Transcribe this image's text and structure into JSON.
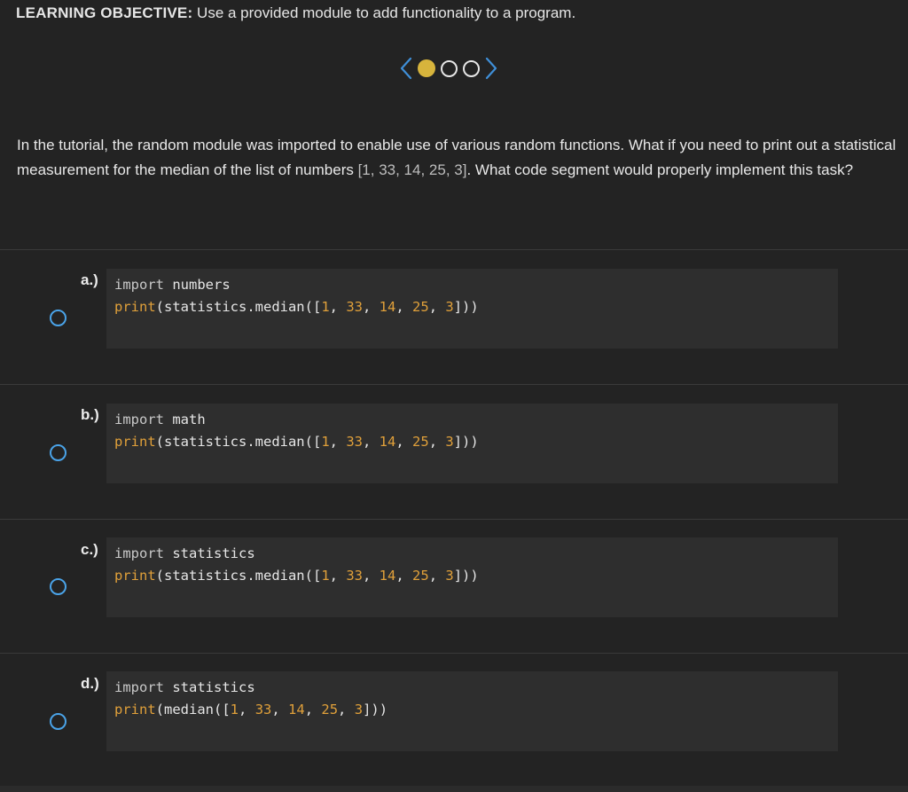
{
  "objective": {
    "label": "LEARNING OBJECTIVE:",
    "text": " Use a provided module to add functionality to a program."
  },
  "pager": {
    "prev_icon": "chevron-left-icon",
    "next_icon": "chevron-right-icon",
    "total": 3,
    "current": 1,
    "colors": {
      "chevron": "#3f8fd8",
      "active": "#d7b43c",
      "inactive": "#e6e6e6"
    }
  },
  "question": {
    "part1": "In the tutorial, the random module was imported to enable use of various random functions. What if you need to print out a statistical measurement for the median of the list of numbers ",
    "numbers": "[1, 33, 14, 25, 3]",
    "part2": ". What code segment would properly implement this task?"
  },
  "options": [
    {
      "letter": "a.)",
      "line1_kw": "import",
      "line1_rest": " numbers",
      "line2_fn": "print",
      "line2_pre": "(statistics.median([",
      "n1": "1",
      "n2": "33",
      "n3": "14",
      "n4": "25",
      "n5": "3",
      "line2_post": "]))"
    },
    {
      "letter": "b.)",
      "line1_kw": "import",
      "line1_rest": " math",
      "line2_fn": "print",
      "line2_pre": "(statistics.median([",
      "n1": "1",
      "n2": "33",
      "n3": "14",
      "n4": "25",
      "n5": "3",
      "line2_post": "]))"
    },
    {
      "letter": "c.)",
      "line1_kw": "import",
      "line1_rest": " statistics",
      "line2_fn": "print",
      "line2_pre": "(statistics.median([",
      "n1": "1",
      "n2": "33",
      "n3": "14",
      "n4": "25",
      "n5": "3",
      "line2_post": "]))"
    },
    {
      "letter": "d.)",
      "line1_kw": "import",
      "line1_rest": " statistics",
      "line2_fn": "print",
      "line2_pre": "(median([",
      "n1": "1",
      "n2": "33",
      "n3": "14",
      "n4": "25",
      "n5": "3",
      "line2_post": "]))"
    }
  ],
  "colors": {
    "background": "#232323",
    "radio": "#4aa3e8",
    "code_bg": "#2e2e2e",
    "code_accent": "#e0a03a"
  }
}
